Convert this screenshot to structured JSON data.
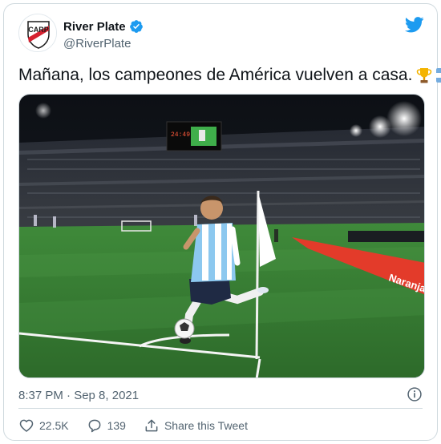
{
  "tweet": {
    "author_name": "River Plate",
    "author_handle": "@RiverPlate",
    "text": "Mañana, los campeones de América vuelven a casa.",
    "timestamp": "8:37 PM · Sep 8, 2021",
    "emojis": [
      "trophy-emoji",
      "argentina-flag-emoji"
    ]
  },
  "media": {
    "scoreboard_text": "24:49",
    "sponsor_text": "Naranja"
  },
  "actions": {
    "likes": "22.5K",
    "replies": "139",
    "share_label": "Share this Tweet"
  },
  "colors": {
    "twitter_blue": "#1d9bf0",
    "text_primary": "#0f1419",
    "text_secondary": "#536471",
    "border": "#cfd9de",
    "club_red": "#d6202f"
  }
}
